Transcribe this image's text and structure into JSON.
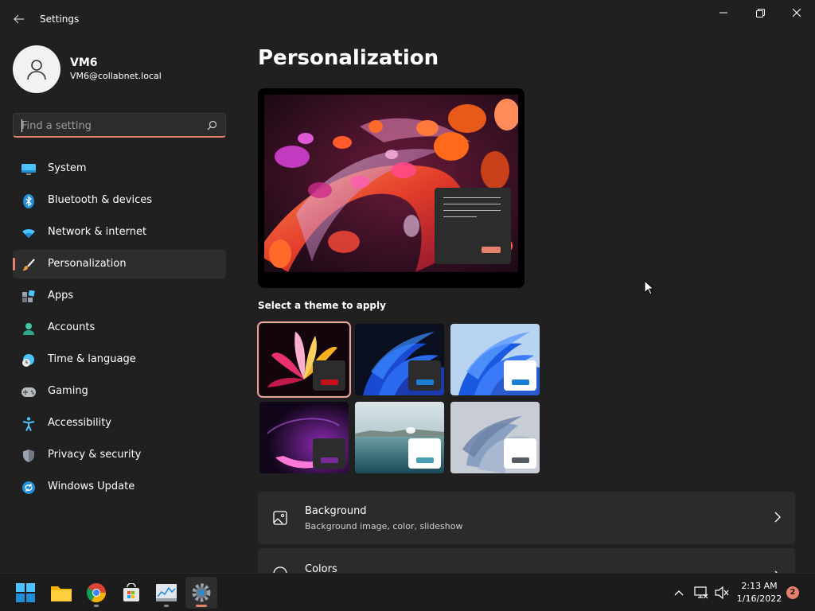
{
  "window": {
    "title": "Settings",
    "accent": "#e3816c"
  },
  "profile": {
    "name": "VM6",
    "email": "VM6@collabnet.local"
  },
  "search": {
    "placeholder": "Find a setting",
    "value": ""
  },
  "nav": {
    "items": [
      {
        "label": "System",
        "icon": "monitor-icon"
      },
      {
        "label": "Bluetooth & devices",
        "icon": "bluetooth-icon"
      },
      {
        "label": "Network & internet",
        "icon": "wifi-icon"
      },
      {
        "label": "Personalization",
        "icon": "brush-icon",
        "active": true
      },
      {
        "label": "Apps",
        "icon": "apps-icon"
      },
      {
        "label": "Accounts",
        "icon": "person-icon"
      },
      {
        "label": "Time & language",
        "icon": "globe-clock-icon"
      },
      {
        "label": "Gaming",
        "icon": "gamepad-icon"
      },
      {
        "label": "Accessibility",
        "icon": "accessibility-icon"
      },
      {
        "label": "Privacy & security",
        "icon": "shield-icon"
      },
      {
        "label": "Windows Update",
        "icon": "update-icon"
      }
    ]
  },
  "main": {
    "title": "Personalization",
    "themes_label": "Select a theme to apply",
    "themes": [
      {
        "name": "theme-glow-dark",
        "swatch": "#2c2c2c",
        "accent": "#c8101c",
        "selected": true
      },
      {
        "name": "theme-bloom-dark",
        "swatch": "#2c2c2c",
        "accent": "#1a7fd4"
      },
      {
        "name": "theme-bloom-light",
        "swatch": "#ffffff",
        "accent": "#1a7fd4"
      },
      {
        "name": "theme-captured-motion",
        "swatch": "#2c2c2c",
        "accent": "#7a2b9a"
      },
      {
        "name": "theme-sunrise-lake",
        "swatch": "#ffffff",
        "accent": "#4a9fb5"
      },
      {
        "name": "theme-flow-light",
        "swatch": "#ffffff",
        "accent": "#555b63"
      }
    ],
    "cards": [
      {
        "title": "Background",
        "subtitle": "Background image, color, slideshow",
        "icon": "image-icon"
      },
      {
        "title": "Colors",
        "subtitle": "",
        "icon": "palette-icon"
      }
    ]
  },
  "taskbar": {
    "time": "2:13 AM",
    "date": "1/16/2022",
    "notification_count": "2"
  }
}
